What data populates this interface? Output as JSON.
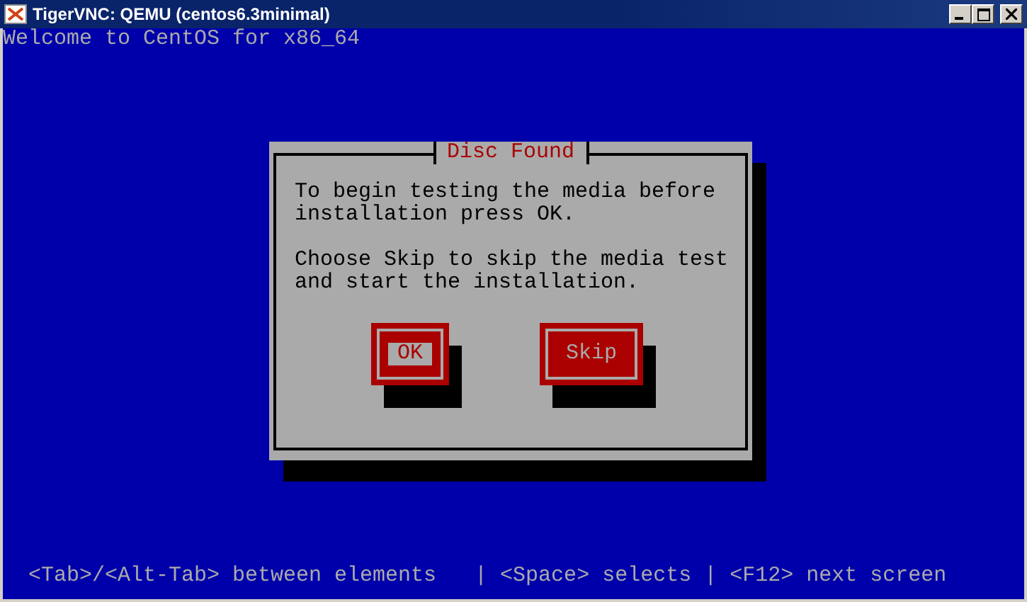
{
  "window": {
    "title": "TigerVNC: QEMU (centos6.3minimal)"
  },
  "console": {
    "header": "Welcome to CentOS for x86_64",
    "status_line": "<Tab>/<Alt-Tab> between elements   | <Space> selects | <F12> next screen"
  },
  "dialog": {
    "title": "Disc Found",
    "paragraphs": [
      "To begin testing the media before installation press OK.",
      "Choose Skip to skip the media test and start the installation."
    ],
    "buttons": [
      {
        "label": "OK",
        "selected": true
      },
      {
        "label": "Skip",
        "selected": false
      }
    ]
  }
}
